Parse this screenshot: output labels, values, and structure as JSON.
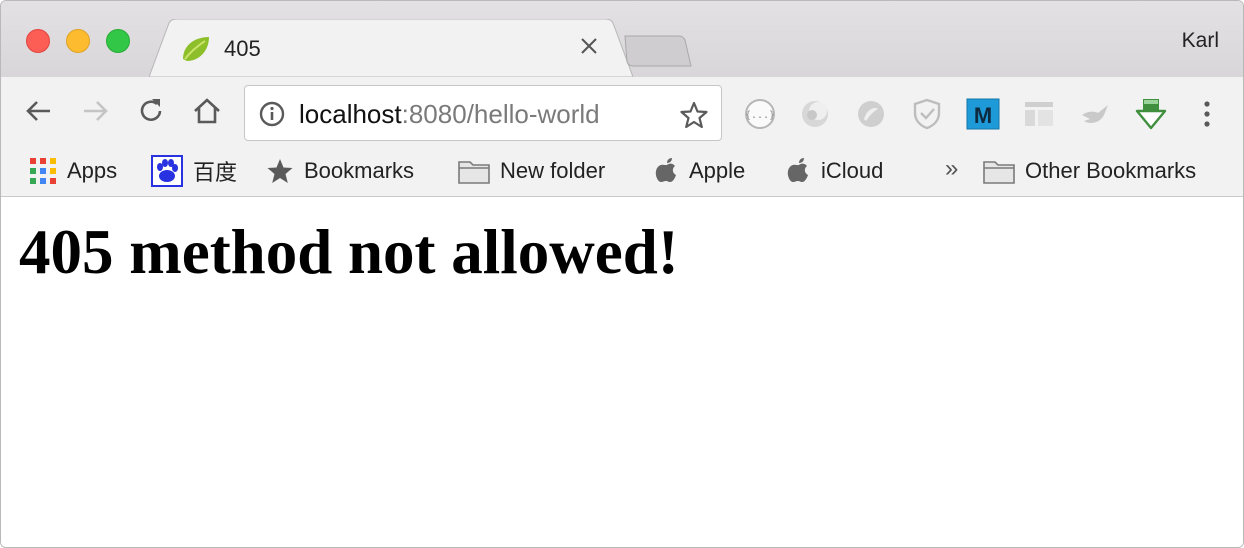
{
  "window": {
    "profile_name": "Karl"
  },
  "tab": {
    "title": "405",
    "favicon": "spring-leaf-icon"
  },
  "toolbar": {
    "address": {
      "host": "localhost",
      "rest": ":8080/hello-world"
    },
    "extensions": [
      "json-viewer-icon",
      "extension-gray-1-icon",
      "extension-gray-2-icon",
      "shield-extension-icon",
      "m-extension-icon",
      "layout-extension-icon",
      "bird-extension-icon",
      "download-extension-icon"
    ]
  },
  "bookmarks": {
    "items": [
      {
        "label": "Apps",
        "icon": "apps-grid-icon"
      },
      {
        "label": "百度",
        "icon": "baidu-paw-icon"
      },
      {
        "label": "Bookmarks",
        "icon": "star-icon"
      },
      {
        "label": "New folder",
        "icon": "folder-icon"
      },
      {
        "label": "Apple",
        "icon": "apple-icon"
      },
      {
        "label": "iCloud",
        "icon": "apple-icon"
      }
    ],
    "overflow": "»",
    "other": "Other Bookmarks"
  },
  "page": {
    "heading": "405 method not allowed!"
  },
  "colors": {
    "close": "#fc5d55",
    "minimize": "#fdbc30",
    "maximize": "#33c748",
    "toolbar_bg": "#f2f2f2"
  }
}
